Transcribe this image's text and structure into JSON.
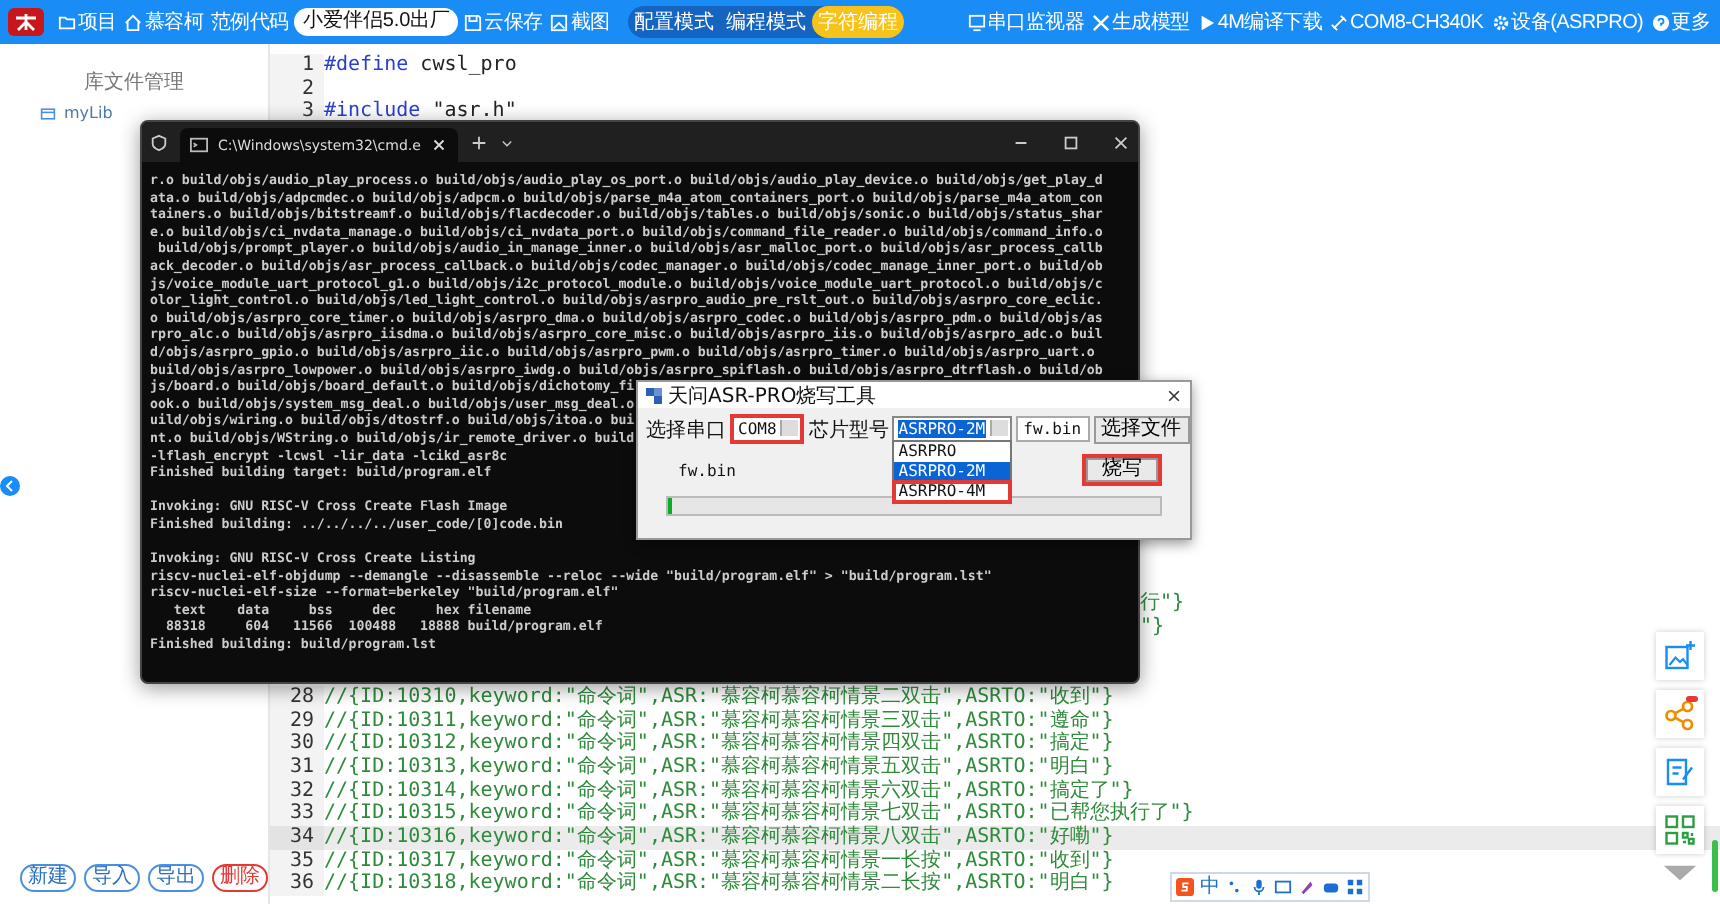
{
  "toolbar": {
    "left": [
      {
        "label": "项目"
      },
      {
        "label": "慕容柯"
      },
      {
        "label": "范例代码"
      }
    ],
    "project_name": "小爱伴侣5.0出厂",
    "actions": [
      {
        "label": "云保存"
      },
      {
        "label": "截图"
      }
    ],
    "modes": [
      {
        "label": "配置模式",
        "selected": false
      },
      {
        "label": "编程模式",
        "selected": false
      },
      {
        "label": "字符编程",
        "selected": true
      }
    ],
    "right": [
      {
        "label": "串口监视器"
      },
      {
        "label": "生成模型"
      },
      {
        "label": "4M编译下载"
      },
      {
        "label": "COM8-CH340K"
      },
      {
        "label": "设备(ASRPRO)"
      },
      {
        "label": "更多"
      }
    ]
  },
  "sidebar": {
    "title": "库文件管理",
    "items": [
      {
        "label": "myLib"
      }
    ],
    "buttons": [
      {
        "label": "新建",
        "kind": "normal"
      },
      {
        "label": "导入",
        "kind": "normal"
      },
      {
        "label": "导出",
        "kind": "normal"
      },
      {
        "label": "删除",
        "kind": "danger"
      }
    ]
  },
  "editor": {
    "top_lines": [
      {
        "number": "1",
        "parts": [
          {
            "kind": "directive",
            "text": "#define"
          },
          {
            "kind": "plain",
            "text": " cwsl_pro"
          }
        ],
        "current": false
      },
      {
        "number": "2",
        "current": false
      },
      {
        "number": "3",
        "parts": [
          {
            "kind": "directive",
            "text": "#include"
          },
          {
            "kind": "plain",
            "text": " \"asr.h\""
          }
        ],
        "current": false
      }
    ],
    "fragments": [
      "行\"}",
      "\"}"
    ],
    "bottom_lines": [
      {
        "number": "28",
        "parts": [
          {
            "kind": "comment",
            "text": "//{ID:10310,keyword:\"命令词\",ASR:\"慕容柯慕容柯情景二双击\",ASRTO:\"收到\"}"
          }
        ],
        "current": false
      },
      {
        "number": "29",
        "parts": [
          {
            "kind": "comment",
            "text": "//{ID:10311,keyword:\"命令词\",ASR:\"慕容柯慕容柯情景三双击\",ASRTO:\"遵命\"}"
          }
        ],
        "current": false
      },
      {
        "number": "30",
        "parts": [
          {
            "kind": "comment",
            "text": "//{ID:10312,keyword:\"命令词\",ASR:\"慕容柯慕容柯情景四双击\",ASRTO:\"搞定\"}"
          }
        ],
        "current": false
      },
      {
        "number": "31",
        "parts": [
          {
            "kind": "comment",
            "text": "//{ID:10313,keyword:\"命令词\",ASR:\"慕容柯慕容柯情景五双击\",ASRTO:\"明白\"}"
          }
        ],
        "current": false
      },
      {
        "number": "32",
        "parts": [
          {
            "kind": "comment",
            "text": "//{ID:10314,keyword:\"命令词\",ASR:\"慕容柯慕容柯情景六双击\",ASRTO:\"搞定了\"}"
          }
        ],
        "current": false
      },
      {
        "number": "33",
        "parts": [
          {
            "kind": "comment",
            "text": "//{ID:10315,keyword:\"命令词\",ASR:\"慕容柯慕容柯情景七双击\",ASRTO:\"已帮您执行了\"}"
          }
        ],
        "current": false
      },
      {
        "number": "34",
        "parts": [
          {
            "kind": "comment",
            "text": "//{ID:10316,keyword:\"命令词\",ASR:\"慕容柯慕容柯情景八双击\",ASRTO:\"好嘞\"}"
          }
        ],
        "current": true
      },
      {
        "number": "35",
        "parts": [
          {
            "kind": "comment",
            "text": "//{ID:10317,keyword:\"命令词\",ASR:\"慕容柯慕容柯情景一长按\",ASRTO:\"收到\"}"
          }
        ],
        "current": false
      },
      {
        "number": "36",
        "parts": [
          {
            "kind": "comment",
            "text": "//{ID:10318,keyword:\"命令词\",ASR:\"慕容柯慕容柯情景二长按\",ASRTO:\"明白\"}"
          }
        ],
        "current": false
      }
    ]
  },
  "terminal": {
    "tab_title": "C:\\Windows\\system32\\cmd.e",
    "lines": [
      {
        "kind": "text",
        "text": "r.o build/objs/audio_play_process.o build/objs/audio_play_os_port.o build/objs/audio_play_device.o build/objs/get_play_d"
      },
      {
        "kind": "text",
        "text": "ata.o build/objs/adpcmdec.o build/objs/adpcm.o build/objs/parse_m4a_atom_containers_port.o build/objs/parse_m4a_atom_con"
      },
      {
        "kind": "text",
        "text": "tainers.o build/objs/bitstreamf.o build/objs/flacdecoder.o build/objs/tables.o build/objs/sonic.o build/objs/status_shar"
      },
      {
        "kind": "text",
        "text": "e.o build/objs/ci_nvdata_manage.o build/objs/ci_nvdata_port.o build/objs/command_file_reader.o build/objs/command_info.o"
      },
      {
        "kind": "text",
        "text": " build/objs/prompt_player.o build/objs/audio_in_manage_inner.o build/objs/asr_malloc_port.o build/objs/asr_process_callb"
      },
      {
        "kind": "text",
        "text": "ack_decoder.o build/objs/asr_process_callback.o build/objs/codec_manager.o build/objs/codec_manage_inner_port.o build/ob"
      },
      {
        "kind": "text",
        "text": "js/voice_module_uart_protocol_g1.o build/objs/i2c_protocol_module.o build/objs/voice_module_uart_protocol.o build/objs/c"
      },
      {
        "kind": "text",
        "text": "olor_light_control.o build/objs/led_light_control.o build/objs/asrpro_audio_pre_rslt_out.o build/objs/asrpro_core_eclic."
      },
      {
        "kind": "text",
        "text": "o build/objs/asrpro_core_timer.o build/objs/asrpro_dma.o build/objs/asrpro_codec.o build/objs/asrpro_pdm.o build/objs/as"
      },
      {
        "kind": "text",
        "text": "rpro_alc.o build/objs/asrpro_iisdma.o build/objs/asrpro_core_misc.o build/objs/asrpro_iis.o build/objs/asrpro_adc.o buil"
      },
      {
        "kind": "text",
        "text": "d/objs/asrpro_gpio.o build/objs/asrpro_iic.o build/objs/asrpro_pwm.o build/objs/asrpro_timer.o build/objs/asrpro_uart.o"
      },
      {
        "kind": "text",
        "text": "build/objs/asrpro_lowpower.o build/objs/asrpro_iwdg.o build/objs/asrpro_spiflash.o build/objs/asrpro_dtrflash.o build/ob"
      },
      {
        "kind": "text",
        "text": "js/board.o build/objs/board_default.o build/objs/dichotomy_fi"
      },
      {
        "kind": "text",
        "text": "ook.o build/objs/system_msg_deal.o build/objs/user_msg_deal.o"
      },
      {
        "kind": "text",
        "text": "uild/objs/wiring.o build/objs/dtostrf.o build/objs/itoa.o bui"
      },
      {
        "kind": "text",
        "text": "nt.o build/objs/WString.o build/objs/ir_remote_driver.o build"
      },
      {
        "kind": "text",
        "text": "-lflash_encrypt -lcwsl -lir_data -lcikd_asr8c"
      },
      {
        "kind": "text",
        "text": "Finished building target: build/program.elf"
      },
      {
        "kind": "blank"
      },
      {
        "kind": "text",
        "text": "Invoking: GNU RISC-V Cross Create Flash Image"
      },
      {
        "kind": "text",
        "text": "Finished building: ../../../../user_code/[0]code.bin"
      },
      {
        "kind": "blank"
      },
      {
        "kind": "text",
        "text": "Invoking: GNU RISC-V Cross Create Listing"
      },
      {
        "kind": "text",
        "text": "riscv-nuclei-elf-objdump --demangle --disassemble --reloc --wide \"build/program.elf\" > \"build/program.lst\""
      },
      {
        "kind": "text",
        "text": "riscv-nuclei-elf-size --format=berkeley \"build/program.elf\""
      },
      {
        "kind": "text",
        "text": "   text\t   data\t    bss\t    dec\t    hex\tfilename"
      },
      {
        "kind": "text",
        "text": "  88318\t    604\t  11566\t 100488\t  18888\tbuild/program.elf"
      },
      {
        "kind": "text",
        "text": "Finished building: build/program.lst"
      }
    ]
  },
  "flash_dialog": {
    "title": "天问ASR-PRO烧写工具",
    "port_label": "选择串口",
    "port_value": "COM8",
    "port_highlighted": true,
    "chip_label": "芯片型号",
    "chip_value": "ASRPRO-2M",
    "chip_options": [
      {
        "label": "ASRPRO",
        "selected": false,
        "highlighted": false
      },
      {
        "label": "ASRPRO-2M",
        "selected": true,
        "highlighted": false
      },
      {
        "label": "ASRPRO-4M",
        "selected": false,
        "highlighted": true
      }
    ],
    "file_value": "fw.bin",
    "choose_button": "选择文件",
    "file_name": "fw.bin",
    "burn_button": "烧写",
    "burn_highlighted": true,
    "progress": {
      "level": 0
    }
  },
  "ime_bar": {
    "label": "中"
  }
}
